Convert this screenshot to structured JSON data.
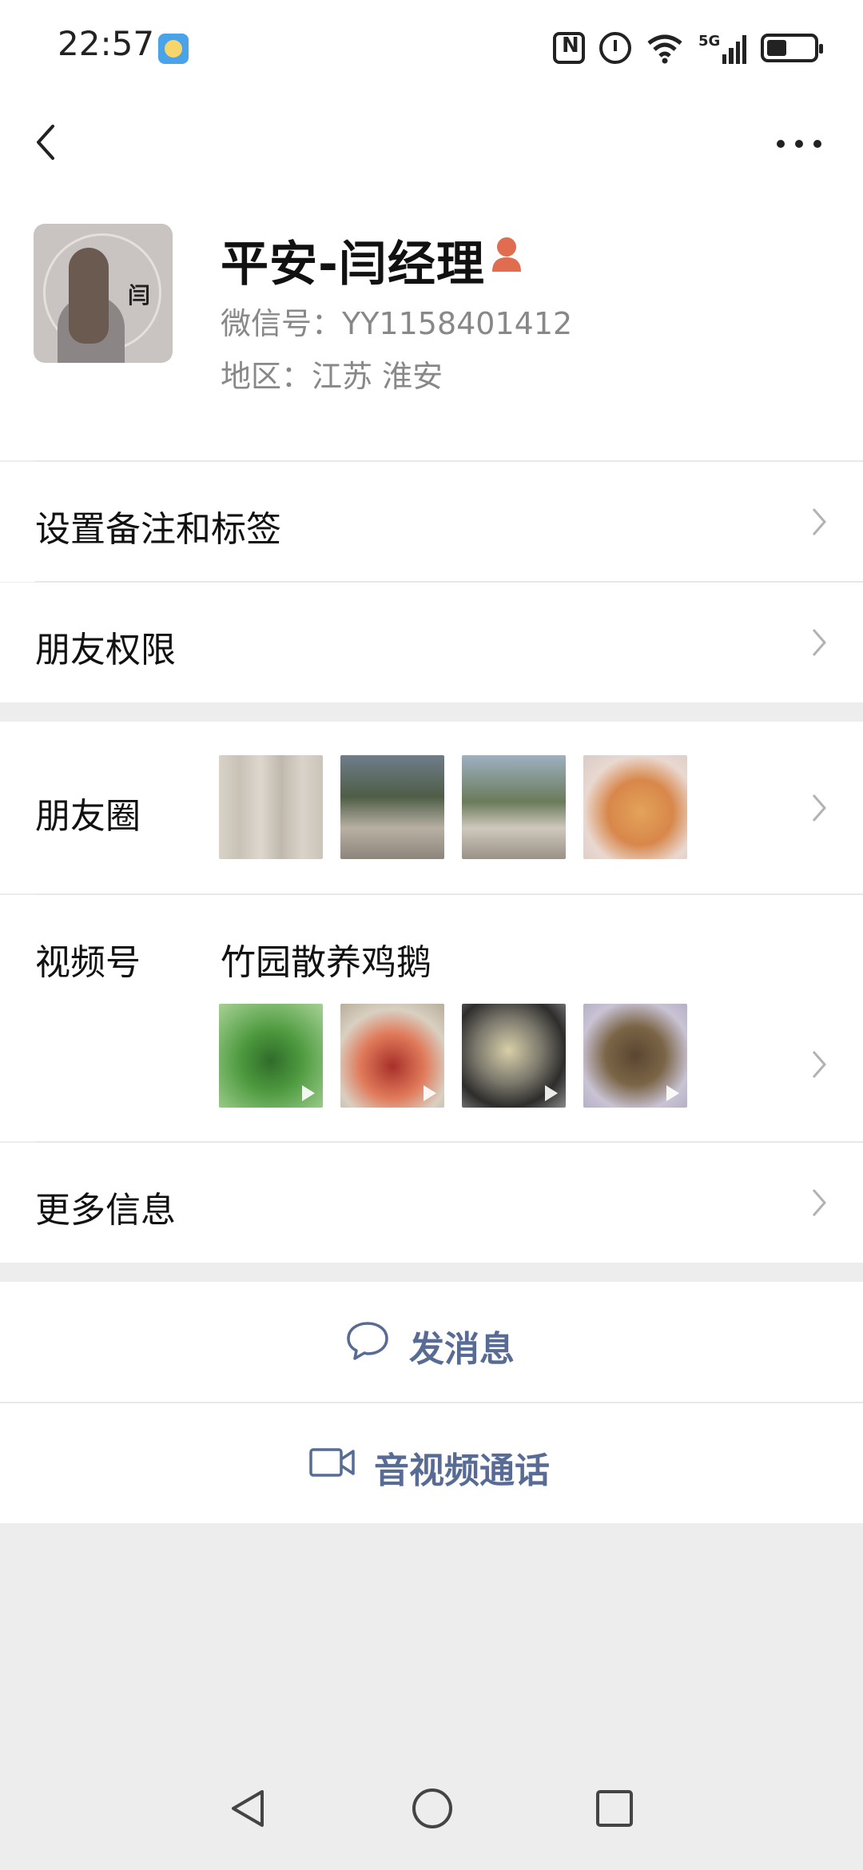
{
  "status_bar": {
    "time": "22:57",
    "network": "5G"
  },
  "header": {
    "back": "back",
    "more": "more"
  },
  "profile": {
    "name": "平安-闫经理",
    "wechat_id": "微信号：YY1158401412",
    "region": "地区：江苏  淮安",
    "avatar_char": "闫"
  },
  "menu": {
    "remark": "设置备注和标签",
    "permissions": "朋友权限",
    "moments": "朋友圈",
    "channels": "视频号",
    "channels_name": "竹园散养鸡鹅",
    "more_info": "更多信息"
  },
  "actions": {
    "message": "发消息",
    "call": "音视频通话"
  },
  "colors": {
    "accent": "#576b95",
    "avatar_badge": "#e06d4f"
  }
}
